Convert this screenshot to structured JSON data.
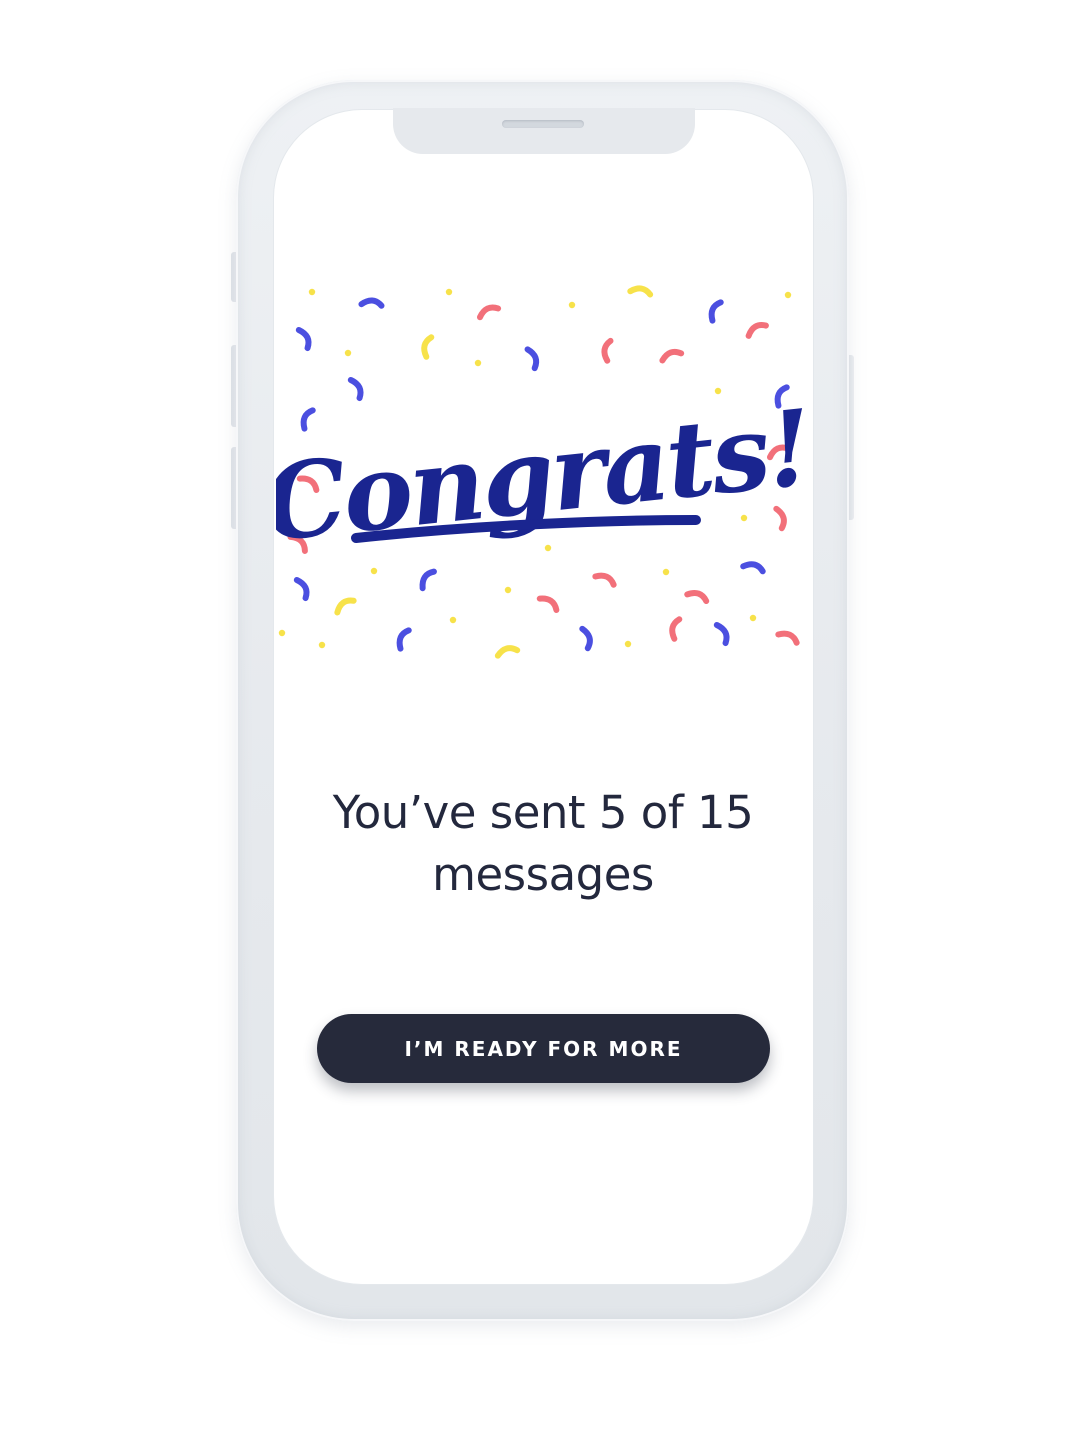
{
  "illustration": {
    "word": "Congrats!",
    "word_color": "#1a2590",
    "confetti_colors": {
      "blue": "#4b4fe0",
      "coral": "#f2707a",
      "yellow": "#f7e24a"
    }
  },
  "progress": {
    "message": "You’ve sent 5 of 15 messages",
    "sent": 5,
    "total": 15
  },
  "cta": {
    "label": "I’M READY FOR MORE",
    "background": "#262a3b"
  }
}
